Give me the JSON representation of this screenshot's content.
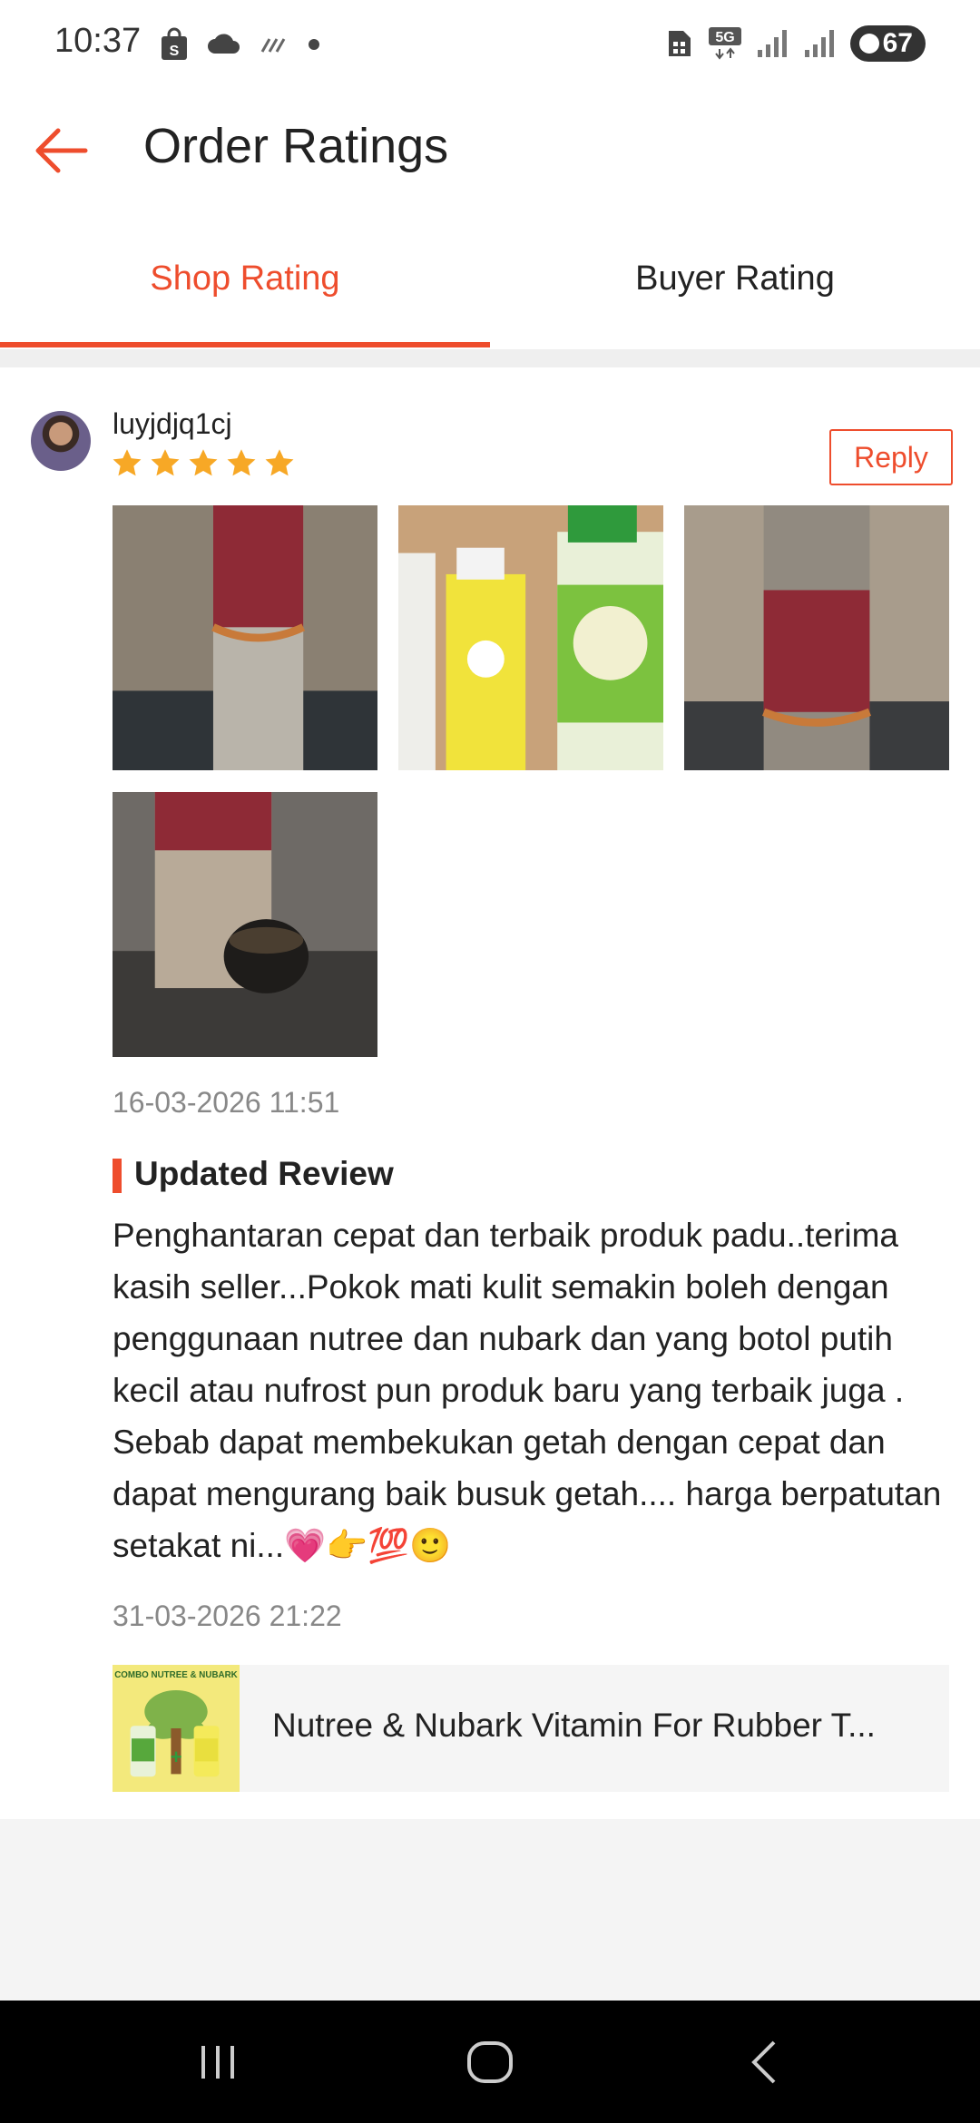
{
  "status_bar": {
    "time": "10:37",
    "left_icons": [
      "shopping-bag-icon",
      "cloud-icon",
      "data-saver-icon",
      "dot-icon"
    ],
    "right_icons": [
      "sim-icon",
      "5g-icon",
      "signal-icon",
      "signal-icon"
    ],
    "battery": "67"
  },
  "header": {
    "title": "Order Ratings",
    "back_icon": "arrow-left-icon"
  },
  "tabs": [
    {
      "label": "Shop Rating",
      "active": true
    },
    {
      "label": "Buyer Rating",
      "active": false
    }
  ],
  "review": {
    "username": "luyjdjq1cj",
    "rating": 5,
    "rating_max": 5,
    "reply_label": "Reply",
    "first_timestamp": "16-03-2026 11:51",
    "updated_title": "Updated Review",
    "text": "Penghantaran cepat dan terbaik produk padu..terima kasih seller...Pokok mati kulit semakin boleh dengan penggunaan nutree dan nubark dan yang botol putih kecil atau nufrost pun produk baru yang terbaik juga . Sebab dapat membekukan getah dengan cepat dan dapat mengurang baik busuk getah.... harga berpatutan setakat ni...💗👉💯🙂",
    "updated_timestamp": "31-03-2026 21:22"
  },
  "product": {
    "name": "Nutree & Nubark Vitamin For Rubber T...",
    "thumb_text": "COMBO NUTREE & NUBARK"
  },
  "colors": {
    "accent": "#ee4d2d",
    "star": "#f7a826",
    "muted_text": "#888888",
    "nav_bar": "#000000"
  },
  "nav_bar": [
    "recent-apps-icon",
    "home-icon",
    "back-icon"
  ]
}
